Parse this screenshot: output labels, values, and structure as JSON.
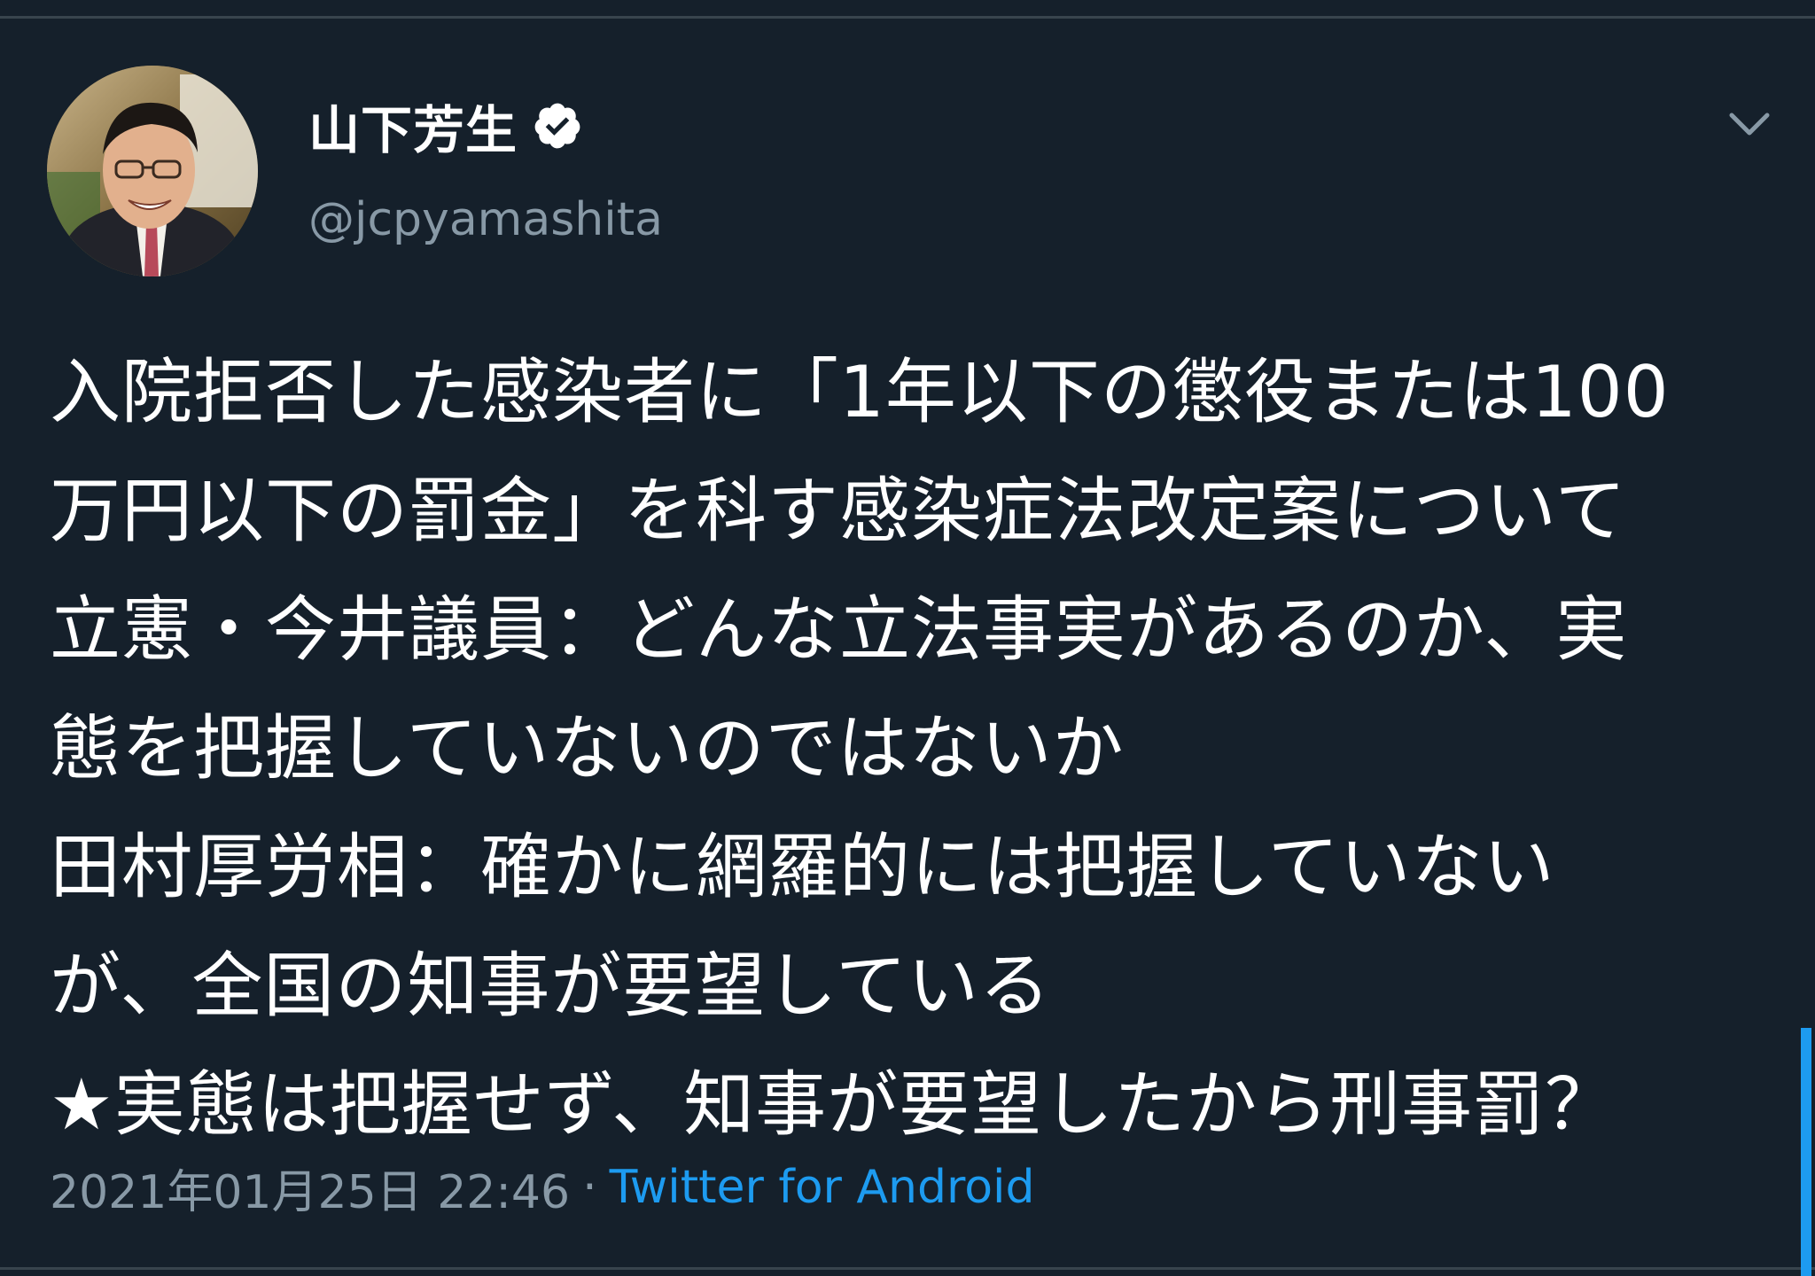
{
  "tweet": {
    "author": {
      "display_name": "山下芳生",
      "handle": "@jcpyamashita",
      "verified": true,
      "avatar_icon": "profile-photo"
    },
    "more_icon": "chevron-down-icon",
    "lines": [
      "入院拒否した感染者に「1年以下の懲役または100",
      "万円以下の罰金」を科す感染症法改定案について",
      "立憲・今井議員：どんな立法事実があるのか、実",
      "態を把握していないのではないか",
      "田村厚労相：確かに網羅的には把握していない",
      "が、全国の知事が要望している",
      "★実態は把握せず、知事が要望したから刑事罰？"
    ],
    "timestamp": "2021年01月25日 22:46",
    "separator": "·",
    "source": "Twitter for Android"
  },
  "colors": {
    "background": "#15202b",
    "text": "#ffffff",
    "secondary_text": "#8899a6",
    "link": "#1d9bf0",
    "divider": "#38444d"
  }
}
